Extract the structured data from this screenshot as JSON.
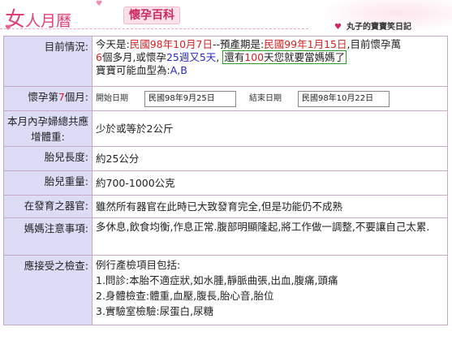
{
  "header": {
    "logo_big": "女",
    "logo_rest": "人月曆",
    "section_title": "懷孕百科",
    "right_title": "丸子的寶寶笑日記"
  },
  "rows": {
    "status": {
      "label": "目前情況:",
      "today_prefix": "今天是:",
      "today_date": "民國98年10月7日",
      "due_prefix": "--預產期是:",
      "due_date": "民國99年1月15日",
      "pregnant_prefix": ",目前懷孕萬",
      "months": "6",
      "months_suffix": "個多月,或懷孕",
      "weeks": "25週又5天",
      "countdown_prefix": "還有",
      "countdown_days": "100",
      "countdown_suffix": "天您就要當媽媽了",
      "blood_prefix": "寶寶可能血型為:",
      "blood_types": "A,B"
    },
    "month": {
      "label_prefix": "懷孕第",
      "label_num": "7",
      "label_suffix": "個月:",
      "start_label": "開始日期",
      "start_value": "民國98年9月25日",
      "end_label": "結束日期",
      "end_value": "民國98年10月22日"
    },
    "weight_gain": {
      "label": "本月內孕婦總共應增體重:",
      "value": "少於或等於2公斤"
    },
    "fetal_length": {
      "label": "胎兒長度:",
      "value": "約25公分"
    },
    "fetal_weight": {
      "label": "胎兒重量:",
      "value": "約700-1000公克"
    },
    "organs": {
      "label": "在發育之器官:",
      "value": "雖然所有器官在此時已大致發育完全,但是功能仍不成熟"
    },
    "mother_notes": {
      "label": "媽媽注意事項:",
      "value": "多休息,飲食均衡,作息正常.腹部明顯隆起,將工作做一調整,不要讓自己太累."
    },
    "checkups": {
      "label": "應接受之檢查:",
      "intro": "例行產檢項目包括:",
      "items": [
        "1.問診:本胎不適症狀,如水腫,靜脈曲張,出血,腹痛,頭痛",
        "2.身體檢查:體重,血壓,腹長,胎心音,胎位",
        "3.實驗室檢驗:尿蛋白,尿糖"
      ]
    }
  },
  "colors": {
    "accent": "#e0407a",
    "label_bg": "#dcdcf7",
    "border": "#c7a9c6",
    "highlight_red": "#d42222",
    "highlight_blue": "#2828c8",
    "box_green": "#2b9b2b"
  }
}
